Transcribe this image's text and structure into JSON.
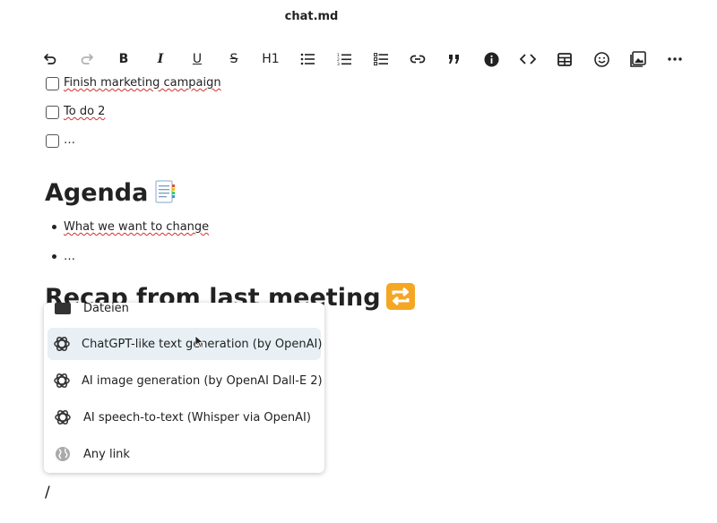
{
  "window": {
    "title": "chat.md"
  },
  "toolbar": {
    "undo": "undo-icon",
    "redo": "redo-icon",
    "bold": "B",
    "italic": "I",
    "underline": "U",
    "strikethrough": "S",
    "heading": "H1",
    "icons": [
      "undo-icon",
      "redo-icon",
      "bold-icon",
      "italic-icon",
      "underline-icon",
      "strikethrough-icon",
      "heading-icon",
      "bullet-list-icon",
      "ordered-list-icon",
      "checklist-icon",
      "link-icon",
      "quote-icon",
      "info-icon",
      "code-icon",
      "table-icon",
      "emoji-icon",
      "image-icon",
      "more-icon"
    ]
  },
  "checklist": [
    {
      "text": "Finish marketing campaign",
      "checked": false
    },
    {
      "text": "To do 2",
      "checked": false
    },
    {
      "text": "…",
      "checked": false
    }
  ],
  "agenda": {
    "heading": "Agenda",
    "emoji": "memo-emoji",
    "items": [
      "What we want to change",
      "…"
    ]
  },
  "recap": {
    "heading": "Recap from last meeting",
    "emoji": "repeat-emoji"
  },
  "menu": {
    "items": [
      {
        "label": "Dateien",
        "icon": "folder-icon"
      },
      {
        "label": "ChatGPT-like text generation (by OpenAI)",
        "icon": "openai-icon",
        "active": true
      },
      {
        "label": "AI image generation (by OpenAI Dall-E 2)",
        "icon": "openai-icon"
      },
      {
        "label": "AI speech-to-text (Whisper via OpenAI)",
        "icon": "openai-icon"
      },
      {
        "label": "Any link",
        "icon": "globe-icon"
      }
    ]
  },
  "editor": {
    "typed_text": "/"
  },
  "colors": {
    "active_item_bg": "#e8f0f5",
    "emoji_orange": "#f5a623",
    "spellcheck_red": "#d32f2f"
  }
}
